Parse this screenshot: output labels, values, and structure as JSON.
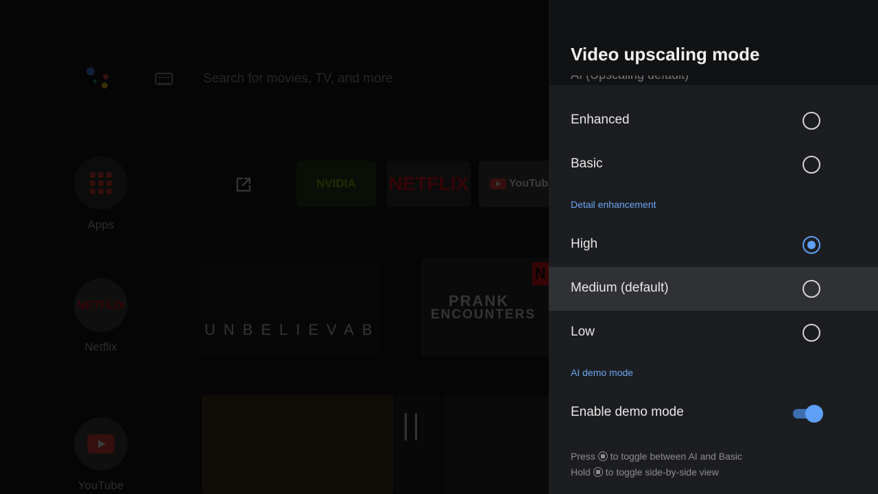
{
  "launcher": {
    "search_text": "Search for movies, TV, and more",
    "apps_label": "Apps",
    "netflix_label": "Netflix",
    "youtube_label": "YouTube",
    "tiles": {
      "nvidia": "NVIDIA",
      "netflix": "NETFLIX",
      "youtube": "YouTube"
    },
    "cards": {
      "unbelievable": "UNBELIEVABLE",
      "prank_line1": "PRANK",
      "prank_line2": "ENCOUNTERS",
      "netflix_badge": "N"
    }
  },
  "panel": {
    "title": "Video upscaling mode",
    "clipped_item": "AI (Upscaling default)",
    "modes": [
      {
        "label": "Enhanced",
        "checked": false
      },
      {
        "label": "Basic",
        "checked": false
      }
    ],
    "detail_header": "Detail enhancement",
    "detail": [
      {
        "label": "High",
        "checked": true
      },
      {
        "label": "Medium (default)",
        "checked": false,
        "focused": true
      },
      {
        "label": "Low",
        "checked": false
      }
    ],
    "demo_header": "AI demo mode",
    "demo_toggle": {
      "label": "Enable demo mode",
      "on": true
    },
    "hints": {
      "press_prefix": "Press",
      "press_suffix": "to toggle between AI and Basic",
      "hold_prefix": "Hold",
      "hold_suffix": "to toggle side-by-side view"
    }
  },
  "colors": {
    "accent": "#5ea0f7",
    "panel_bg": "#1c1d20",
    "focus_bg": "#303134"
  }
}
